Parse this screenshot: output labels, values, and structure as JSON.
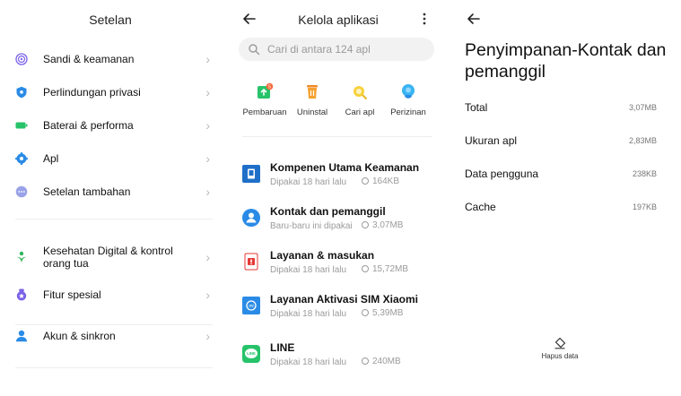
{
  "settings": {
    "title": "Setelan",
    "items": [
      {
        "label": "Sandi & keamanan",
        "icon": "fingerprint-icon",
        "color": "#7b61e8"
      },
      {
        "label": "Perlindungan privasi",
        "icon": "shield-icon",
        "color": "#2a8be6"
      },
      {
        "label": "Baterai & performa",
        "icon": "battery-icon",
        "color": "#27c36a"
      },
      {
        "label": "Apl",
        "icon": "gear-icon",
        "color": "#2a8be6"
      },
      {
        "label": "Setelan tambahan",
        "icon": "more-dots-icon",
        "color": "#9aa3e8"
      },
      {
        "label": "Kesehatan Digital & kontrol\norang tua",
        "icon": "digital-wellbeing-icon",
        "color": "#2fb55d"
      },
      {
        "label": "Fitur spesial",
        "icon": "special-features-icon",
        "color": "#7b61e8"
      },
      {
        "label": "Akun & sinkron",
        "icon": "account-icon",
        "color": "#2a8be6"
      }
    ]
  },
  "manage_apps": {
    "title": "Kelola aplikasi",
    "search_placeholder": "Cari di antara 124 apl",
    "quick_actions": [
      {
        "label": "Pembaruan",
        "icon": "update-icon",
        "badge": "5"
      },
      {
        "label": "Uninstal",
        "icon": "trash-icon"
      },
      {
        "label": "Cari apl",
        "icon": "find-app-icon"
      },
      {
        "label": "Perizinan",
        "icon": "permissions-icon"
      }
    ],
    "apps": [
      {
        "name": "Kompenen Utama Keamanan",
        "meta": "Dipakai 18 hari lalu",
        "size": "164KB",
        "icon": "security-component-icon"
      },
      {
        "name": "Kontak dan pemanggil",
        "meta": "Baru-baru ini dipakai",
        "size": "3,07MB",
        "icon": "contacts-icon"
      },
      {
        "name": "Layanan & masukan",
        "meta": "Dipakai 18 hari lalu",
        "size": "15,72MB",
        "icon": "feedback-icon"
      },
      {
        "name": "Layanan Aktivasi SIM Xiaomi",
        "meta": "Dipakai 18 hari lalu",
        "size": "5,39MB",
        "icon": "sim-activation-icon"
      },
      {
        "name": "LINE",
        "meta": "Dipakai 18 hari lalu",
        "size": "240MB",
        "icon": "line-app-icon"
      }
    ]
  },
  "storage": {
    "title": "Penyimpanan-Kontak dan pemanggil",
    "rows": [
      {
        "label": "Total",
        "value": "3,07MB"
      },
      {
        "label": "Ukuran apl",
        "value": "2,83MB"
      },
      {
        "label": "Data pengguna",
        "value": "238KB"
      },
      {
        "label": "Cache",
        "value": "197KB"
      }
    ],
    "clear_label": "Hapus data"
  }
}
